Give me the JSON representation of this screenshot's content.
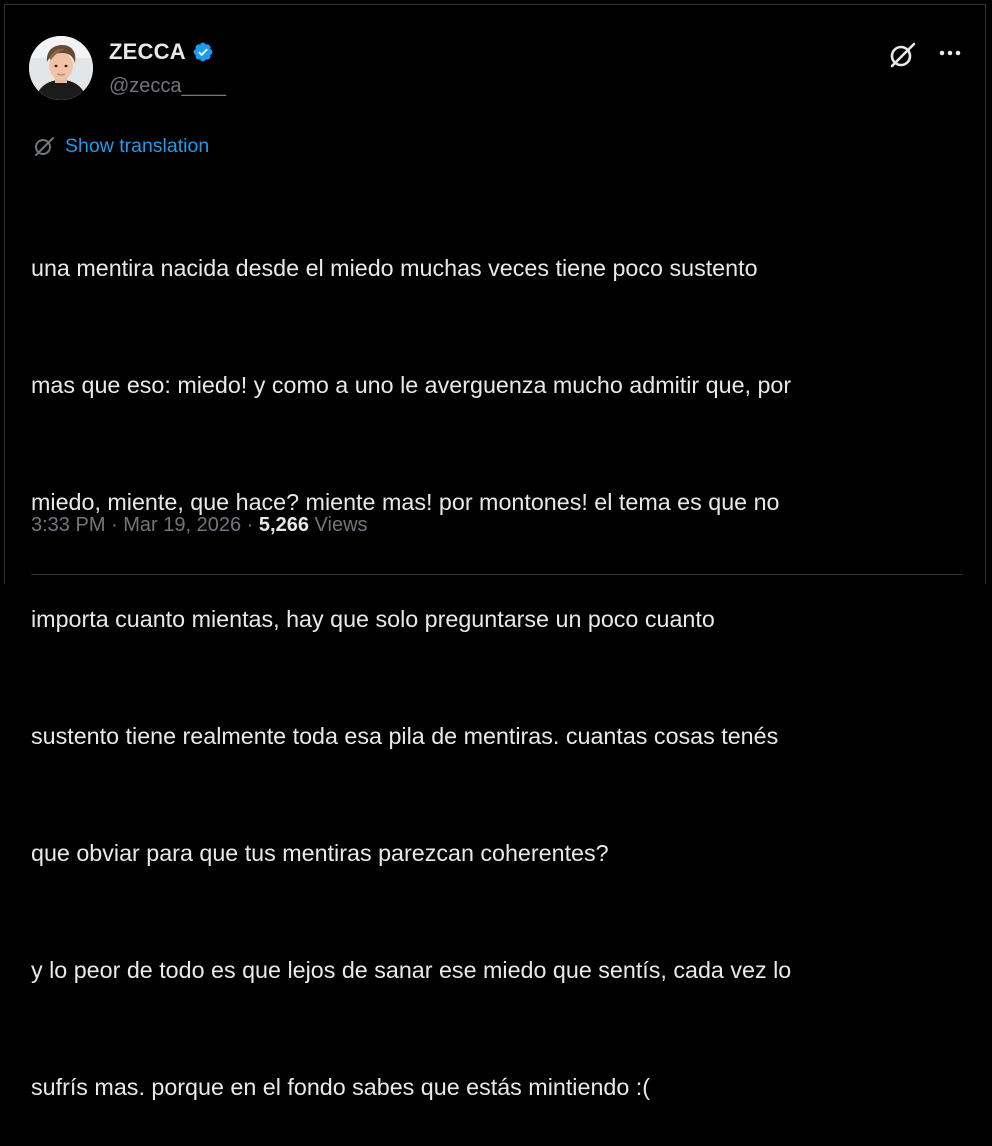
{
  "author": {
    "display_name": "ZECCA",
    "handle": "@zecca____",
    "verified": true,
    "avatar_icon": "avatar-photo"
  },
  "actions": {
    "grok_icon": "grok-icon",
    "more_icon": "more-options-icon"
  },
  "translation": {
    "icon": "globe-translate-icon",
    "label": "Show translation"
  },
  "tweet": {
    "lines": [
      "una mentira nacida desde el miedo muchas veces tiene poco sustento",
      "mas que eso: miedo! y como a uno le averguenza mucho admitir que, por",
      "miedo, miente, que hace? miente mas! por montones! el tema es que no",
      "importa cuanto mientas, hay que solo preguntarse un poco cuanto",
      "sustento tiene realmente toda esa pila de mentiras. cuantas cosas tenés",
      "que obviar para que tus mentiras parezcan coherentes?",
      "y lo peor de todo es que lejos de sanar ese miedo que sentís, cada vez lo",
      "sufrís mas. porque en el fondo sabes que estás mintiendo :("
    ]
  },
  "meta": {
    "time": "3:33 PM",
    "separator": " · ",
    "date": "Mar 19, 2026",
    "views_count": "5,266",
    "views_label": " Views"
  },
  "colors": {
    "background": "#000000",
    "text": "#e7e9ea",
    "secondary": "#71767b",
    "accent": "#1d9bf0",
    "border": "#2f3336"
  }
}
